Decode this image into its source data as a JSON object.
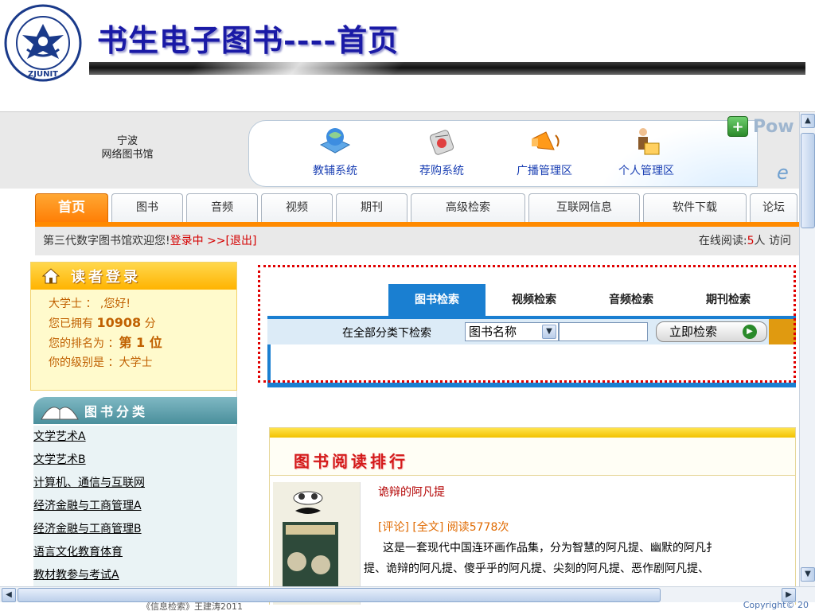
{
  "slide": {
    "title": "书生电子图书----首页",
    "logo_text": "ZJUNIT"
  },
  "header": {
    "library_name_line1": "宁波",
    "library_name_line2": "网络图书馆",
    "systems": [
      {
        "label": "教辅系统",
        "icon": "globe-book-icon"
      },
      {
        "label": "荐购系统",
        "icon": "newspaper-icon"
      },
      {
        "label": "广播管理区",
        "icon": "megaphone-icon"
      },
      {
        "label": "个人管理区",
        "icon": "person-folder-icon"
      }
    ],
    "powered_text": "Pow"
  },
  "nav": {
    "tabs": [
      {
        "label": "首页",
        "active": true
      },
      {
        "label": "图书"
      },
      {
        "label": "音频"
      },
      {
        "label": "视频"
      },
      {
        "label": "期刊"
      },
      {
        "label": "高级检索"
      },
      {
        "label": "互联网信息"
      },
      {
        "label": "软件下载"
      },
      {
        "label": "论坛"
      }
    ]
  },
  "welcome": {
    "greeting": "第三代数字图书馆欢迎您!",
    "status": "登录中",
    "logout": ">>[退出]",
    "online_label": "在线阅读:",
    "online_count": "5",
    "online_unit": "人",
    "visit_label": "访问"
  },
  "login": {
    "heading": "读者登录",
    "line1": "大学士 ： ,您好!",
    "own_label": "您已拥有",
    "points": "10908",
    "points_unit": "分",
    "rank_label": "您的排名为 ：",
    "rank_value": "第 1 位",
    "level_line": "你的级别是 ：大学士"
  },
  "categories": {
    "heading": "图书分类",
    "items": [
      "文学艺术A",
      "文学艺术B",
      "计算机、通信与互联网",
      "经济金融与工商管理A",
      "经济金融与工商管理B",
      "语言文化教育体育",
      "教材教参与考试A"
    ]
  },
  "search": {
    "tabs": [
      "图书检索",
      "视频检索",
      "音频检索",
      "期刊检索"
    ],
    "scope_label": "在全部分类下检索",
    "field_selected": "图书名称",
    "input_value": "",
    "button_label": "立即检索"
  },
  "ranking": {
    "title": "图书阅读排行",
    "book_title": "诡辩的阿凡提",
    "meta": "[评论] [全文] 阅读5778次",
    "desc_line1": "这是一套现代中国连环画作品集，分为智慧的阿凡提、幽默的阿凡扌",
    "desc_line2": "提、诡辩的阿凡提、傻乎乎的阿凡提、尖刻的阿凡提、恶作剧阿凡提、"
  },
  "footer": {
    "left": "《信息检索》王建涛2011",
    "right": "Copyright© 20"
  }
}
